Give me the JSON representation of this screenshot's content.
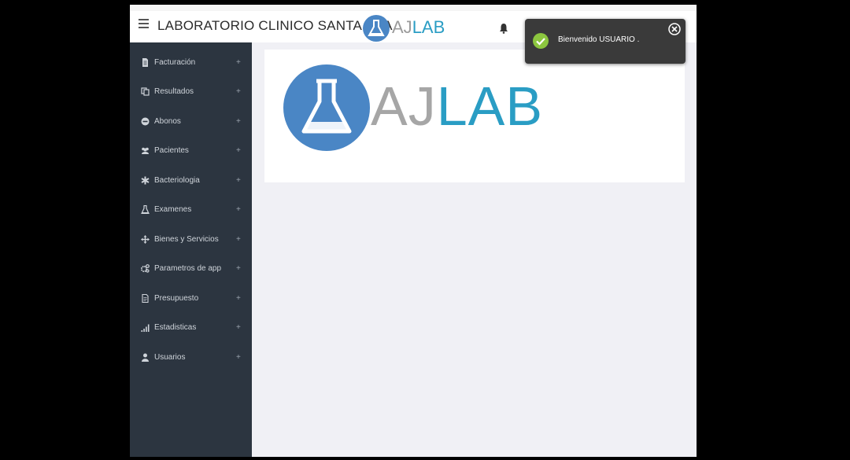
{
  "header": {
    "title": "LABORATORIO CLINICO SANTA ANA",
    "logo_text_aj": "AJ",
    "logo_text_lab": "LAB"
  },
  "sidebar": {
    "items": [
      {
        "label": "Facturación",
        "icon": "invoice-icon"
      },
      {
        "label": "Resultados",
        "icon": "copy-icon"
      },
      {
        "label": "Abonos",
        "icon": "minus-circle-icon"
      },
      {
        "label": "Pacientes",
        "icon": "users-icon"
      },
      {
        "label": "Bacteriologia",
        "icon": "asterisk-icon"
      },
      {
        "label": "Examenes",
        "icon": "flask-icon"
      },
      {
        "label": "Bienes y Servicios",
        "icon": "move-icon"
      },
      {
        "label": "Parametros de app",
        "icon": "gears-icon"
      },
      {
        "label": "Presupuesto",
        "icon": "file-icon"
      },
      {
        "label": "Estadisticas",
        "icon": "signal-icon"
      },
      {
        "label": "Usuarios",
        "icon": "user-icon"
      }
    ],
    "expand_symbol": "+"
  },
  "main": {
    "logo_text_aj": "AJ",
    "logo_text_lab": "LAB"
  },
  "toast": {
    "message": "Bienvenido USUARIO ."
  },
  "colors": {
    "sidebar_bg": "#2c3540",
    "accent": "#2a9dc4",
    "logo_circle": "#4a86c5",
    "toast_bg": "#3a3a3a",
    "success": "#8cc63f"
  }
}
